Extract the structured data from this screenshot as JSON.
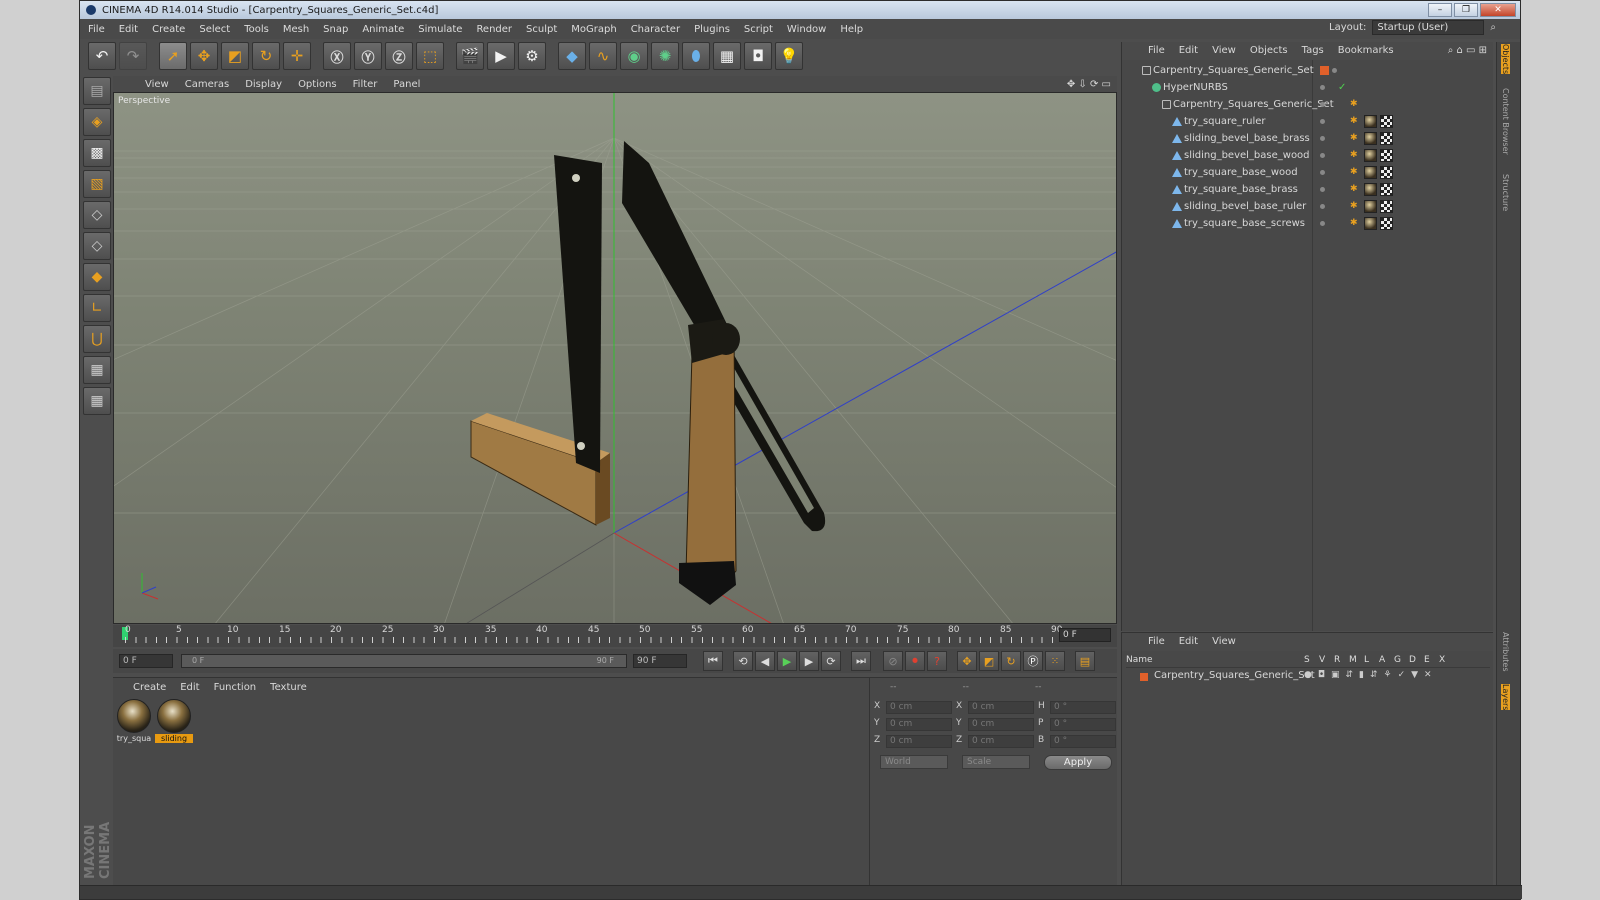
{
  "window": {
    "title": "CINEMA 4D R14.014 Studio - [Carpentry_Squares_Generic_Set.c4d]",
    "buttons": [
      "–",
      "❐",
      "✕"
    ]
  },
  "menubar": [
    "File",
    "Edit",
    "Create",
    "Select",
    "Tools",
    "Mesh",
    "Snap",
    "Animate",
    "Simulate",
    "Render",
    "Sculpt",
    "MoGraph",
    "Character",
    "Plugins",
    "Script",
    "Window",
    "Help"
  ],
  "layout": {
    "label": "Layout:",
    "value": "Startup (User)"
  },
  "viewport": {
    "menu": [
      "View",
      "Cameras",
      "Display",
      "Options",
      "Filter",
      "Panel"
    ],
    "label": "Perspective"
  },
  "timeline": {
    "ticks": [
      "0",
      "5",
      "10",
      "15",
      "20",
      "25",
      "30",
      "35",
      "40",
      "45",
      "50",
      "55",
      "60",
      "65",
      "70",
      "75",
      "80",
      "85",
      "90"
    ],
    "current_frame": "0 F"
  },
  "transport": {
    "start": "0 F",
    "range_start": "0 F",
    "range_end": "90 F",
    "end": "90 F"
  },
  "materials": {
    "menu": [
      "Create",
      "Edit",
      "Function",
      "Texture"
    ],
    "items": [
      {
        "label": "try_squa"
      },
      {
        "label": "sliding"
      }
    ]
  },
  "coordinates": {
    "header": [
      "--",
      "--",
      "--"
    ],
    "rows": [
      {
        "a": "X",
        "av": "0 cm",
        "b": "X",
        "bv": "0 cm",
        "c": "H",
        "cv": "0 °"
      },
      {
        "a": "Y",
        "av": "0 cm",
        "b": "Y",
        "bv": "0 cm",
        "c": "P",
        "cv": "0 °"
      },
      {
        "a": "Z",
        "av": "0 cm",
        "b": "Z",
        "bv": "0 cm",
        "c": "B",
        "cv": "0 °"
      }
    ],
    "mode": "World",
    "scale": "Scale",
    "apply": "Apply"
  },
  "objects": {
    "menu": [
      "File",
      "Edit",
      "View",
      "Objects",
      "Tags",
      "Bookmarks"
    ],
    "tree": [
      {
        "name": "Carpentry_Squares_Generic_Set",
        "type": "null",
        "level": 0
      },
      {
        "name": "HyperNURBS",
        "type": "hypernurbs",
        "level": 1
      },
      {
        "name": "Carpentry_Squares_Generic_Set",
        "type": "null",
        "level": 2
      },
      {
        "name": "try_square_ruler",
        "type": "poly",
        "level": 3
      },
      {
        "name": "sliding_bevel_base_brass",
        "type": "poly",
        "level": 3
      },
      {
        "name": "sliding_bevel_base_wood",
        "type": "poly",
        "level": 3
      },
      {
        "name": "try_square_base_wood",
        "type": "poly",
        "level": 3
      },
      {
        "name": "try_square_base_brass",
        "type": "poly",
        "level": 3
      },
      {
        "name": "sliding_bevel_base_ruler",
        "type": "poly",
        "level": 3
      },
      {
        "name": "try_square_base_screws",
        "type": "poly",
        "level": 3
      }
    ]
  },
  "layers": {
    "menu": [
      "File",
      "Edit",
      "View"
    ],
    "columns": [
      "Name",
      "S",
      "V",
      "R",
      "M",
      "L",
      "A",
      "G",
      "D",
      "E",
      "X"
    ],
    "rows": [
      {
        "name": "Carpentry_Squares_Generic_Set",
        "color": "#e0602a"
      }
    ]
  },
  "side_tabs": [
    "Objects",
    "Content Browser",
    "Structure",
    "Attributes",
    "Layers"
  ],
  "brand": "MAXON CINEMA 4D",
  "colors": {
    "accent": "#e8a020",
    "wood": "#8a6a3a",
    "metal": "#1a1a14",
    "axis_x": "#c83030",
    "axis_y": "#30c030",
    "axis_z": "#3040c8"
  }
}
